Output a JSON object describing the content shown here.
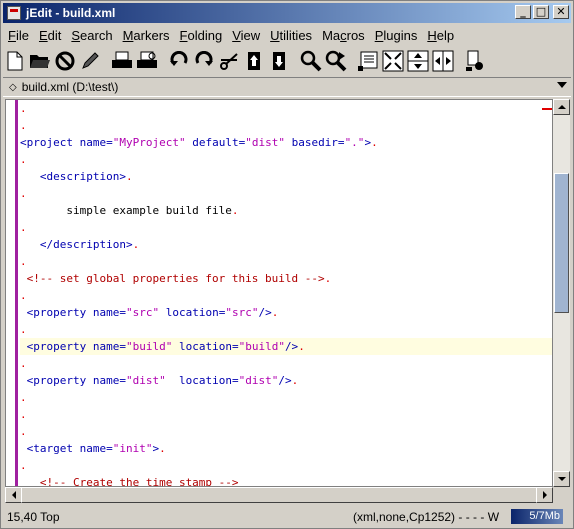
{
  "window": {
    "title": "jEdit - build.xml",
    "minimize": "_",
    "maximize": "□",
    "close": "✕"
  },
  "menu": [
    {
      "label": "File",
      "mnemonic": "F",
      "rest": "ile"
    },
    {
      "label": "Edit",
      "mnemonic": "E",
      "rest": "dit"
    },
    {
      "label": "Search",
      "mnemonic": "S",
      "rest": "earch"
    },
    {
      "label": "Markers",
      "mnemonic": "M",
      "rest": "arkers"
    },
    {
      "label": "Folding",
      "mnemonic": "F",
      "rest": "olding"
    },
    {
      "label": "View",
      "mnemonic": "V",
      "rest": "iew"
    },
    {
      "label": "Utilities",
      "mnemonic": "U",
      "rest": "tilities"
    },
    {
      "label": "Macros",
      "mnemonic": "c",
      "pre": "Ma",
      "rest": "ros"
    },
    {
      "label": "Plugins",
      "mnemonic": "P",
      "rest": "lugins"
    },
    {
      "label": "Help",
      "mnemonic": "H",
      "rest": "elp"
    }
  ],
  "toolbar": {
    "icons": [
      "new-file-icon",
      "open-file-icon",
      "close-file-icon",
      "edit-pencil-icon",
      "print-icon",
      "print-preview-icon",
      "undo-icon",
      "redo-icon",
      "cut-icon",
      "copy-icon",
      "paste-icon",
      "find-icon",
      "find-next-icon",
      "view-options-icon",
      "split-icon",
      "split-horizontal-icon",
      "split-vertical-icon",
      "plugin-manager-icon"
    ]
  },
  "buffer": {
    "label": "build.xml (D:\\test\\)"
  },
  "editor": {
    "lines": [
      {
        "dot": ".",
        "content": []
      },
      {
        "dot": ".",
        "content": []
      },
      {
        "dot": "",
        "content": [
          {
            "t": "<project ",
            "c": "tag"
          },
          {
            "t": "name=",
            "c": "attr"
          },
          {
            "t": "\"MyProject\"",
            "c": "val"
          },
          {
            "t": " default=",
            "c": "attr"
          },
          {
            "t": "\"dist\"",
            "c": "val"
          },
          {
            "t": " basedir=",
            "c": "attr"
          },
          {
            "t": "\".\"",
            "c": "val"
          },
          {
            "t": ">",
            "c": "tag"
          },
          {
            "t": ".",
            "c": "dot"
          }
        ]
      },
      {
        "dot": ".",
        "content": []
      },
      {
        "dot": "",
        "content": [
          {
            "t": "   <description>",
            "c": "tag"
          },
          {
            "t": ".",
            "c": "dot"
          }
        ]
      },
      {
        "dot": ".",
        "content": []
      },
      {
        "dot": "",
        "content": [
          {
            "t": "       simple example build file",
            "c": "text"
          },
          {
            "t": ".",
            "c": "dot"
          }
        ]
      },
      {
        "dot": ".",
        "content": []
      },
      {
        "dot": "",
        "content": [
          {
            "t": "   </description>",
            "c": "tag"
          },
          {
            "t": ".",
            "c": "dot"
          }
        ]
      },
      {
        "dot": ".",
        "content": []
      },
      {
        "dot": "",
        "content": [
          {
            "t": " <!-- set global properties for this build -->",
            "c": "comment"
          },
          {
            "t": ".",
            "c": "dot"
          }
        ]
      },
      {
        "dot": ".",
        "content": []
      },
      {
        "dot": "",
        "content": [
          {
            "t": " <property ",
            "c": "tag"
          },
          {
            "t": "name=",
            "c": "attr"
          },
          {
            "t": "\"src\"",
            "c": "val"
          },
          {
            "t": " location=",
            "c": "attr"
          },
          {
            "t": "\"src\"",
            "c": "val"
          },
          {
            "t": "/>",
            "c": "tag"
          },
          {
            "t": ".",
            "c": "dot"
          }
        ]
      },
      {
        "dot": ".",
        "content": []
      },
      {
        "dot": "",
        "current": true,
        "content": [
          {
            "t": " <property ",
            "c": "tag"
          },
          {
            "t": "name=",
            "c": "attr"
          },
          {
            "t": "\"build\"",
            "c": "val"
          },
          {
            "t": " location=",
            "c": "attr"
          },
          {
            "t": "\"build\"",
            "c": "val"
          },
          {
            "t": "/>",
            "c": "tag"
          },
          {
            "t": ".",
            "c": "dot"
          }
        ]
      },
      {
        "dot": ".",
        "content": []
      },
      {
        "dot": "",
        "content": [
          {
            "t": " <property ",
            "c": "tag"
          },
          {
            "t": "name=",
            "c": "attr"
          },
          {
            "t": "\"dist\"",
            "c": "val"
          },
          {
            "t": "  location=",
            "c": "attr"
          },
          {
            "t": "\"dist\"",
            "c": "val"
          },
          {
            "t": "/>",
            "c": "tag"
          },
          {
            "t": ".",
            "c": "dot"
          }
        ]
      },
      {
        "dot": ".",
        "content": []
      },
      {
        "dot": ".",
        "content": []
      },
      {
        "dot": ".",
        "content": []
      },
      {
        "dot": "",
        "content": [
          {
            "t": " <target ",
            "c": "tag"
          },
          {
            "t": "name=",
            "c": "attr"
          },
          {
            "t": "\"init\"",
            "c": "val"
          },
          {
            "t": ">",
            "c": "tag"
          },
          {
            "t": ".",
            "c": "dot"
          }
        ]
      },
      {
        "dot": ".",
        "content": []
      },
      {
        "dot": "",
        "content": [
          {
            "t": "   <!-- Create the time stamp -->",
            "c": "comment"
          }
        ]
      }
    ]
  },
  "status": {
    "position": "15,40 Top",
    "mode": "(xml,none,Cp1252) - - - - W",
    "memory": "5/7Mb"
  }
}
